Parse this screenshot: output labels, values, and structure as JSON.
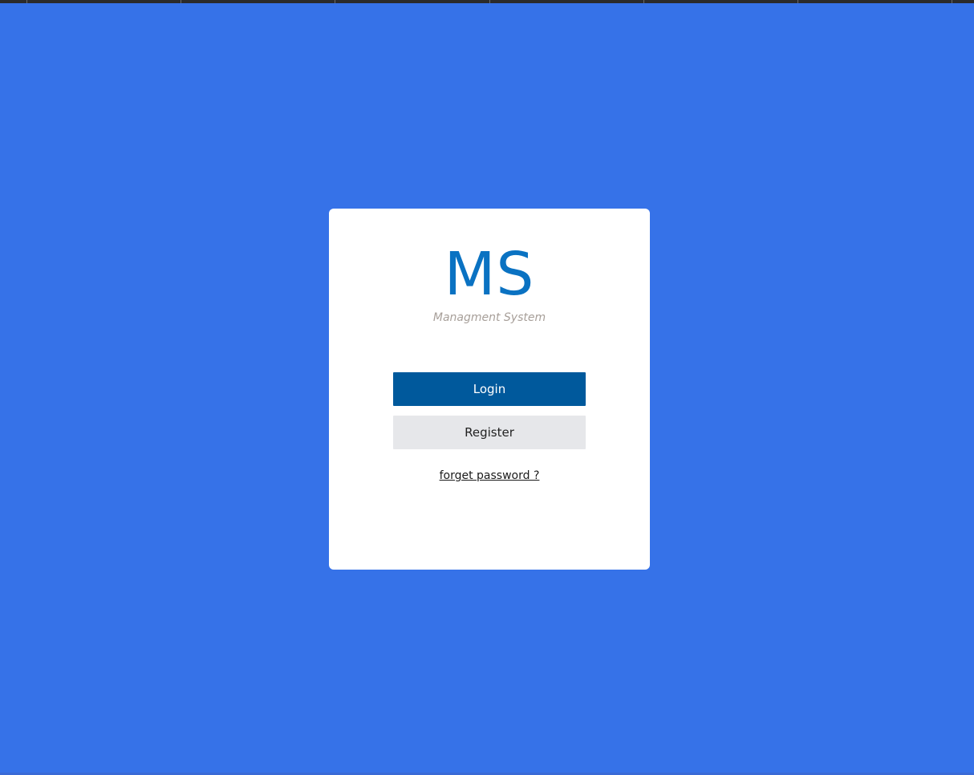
{
  "logo": {
    "title": "MS",
    "subtitle": "Managment System"
  },
  "actions": {
    "login_label": "Login",
    "register_label": "Register",
    "forgot_label": "forget password ?"
  },
  "colors": {
    "background": "#3672e8",
    "card": "#ffffff",
    "logo_title": "#0a72c2",
    "logo_subtitle": "#a79f99",
    "login_button": "#00599c",
    "register_button": "#e6e7ea"
  }
}
